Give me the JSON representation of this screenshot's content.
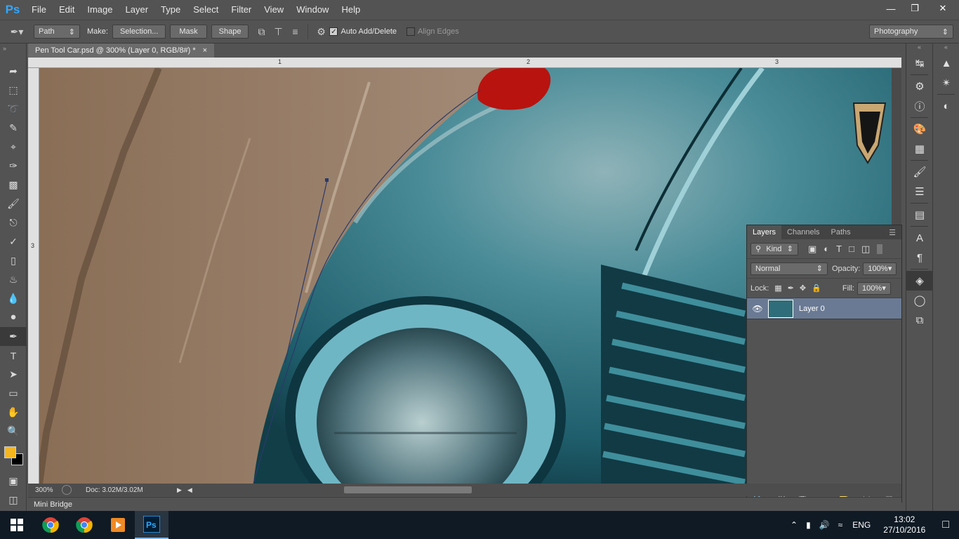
{
  "app": {
    "logo": "Ps",
    "menu": [
      "File",
      "Edit",
      "Image",
      "Layer",
      "Type",
      "Select",
      "Filter",
      "View",
      "Window",
      "Help"
    ],
    "window_controls": [
      "minimize",
      "restore",
      "close"
    ]
  },
  "options_bar": {
    "tool_mode": "Path",
    "make_label": "Make:",
    "selection_btn": "Selection...",
    "mask_btn": "Mask",
    "shape_btn": "Shape",
    "auto_add_delete": {
      "label": "Auto Add/Delete",
      "checked": true
    },
    "align_edges": {
      "label": "Align Edges",
      "checked": false
    },
    "workspace": "Photography"
  },
  "tools": [
    "move-tool",
    "marquee-tool",
    "lasso-tool",
    "quick-selection-tool",
    "crop-tool",
    "eyedropper-tool",
    "spot-healing-tool",
    "brush-tool",
    "clone-stamp-tool",
    "history-brush-tool",
    "eraser-tool",
    "paint-bucket-tool",
    "blur-tool",
    "dodge-tool",
    "pen-tool",
    "type-tool",
    "path-selection-tool",
    "rectangle-tool",
    "hand-tool",
    "zoom-tool"
  ],
  "colors": {
    "foreground": "#f4b621",
    "background": "#000000",
    "accent": "#31a8ff",
    "selected_layer": "#6a7a94"
  },
  "document": {
    "tab_title": "Pen Tool Car.psd @ 300% (Layer 0, RGB/8#) *",
    "ruler_top_marks": [
      "1",
      "2",
      "3"
    ],
    "ruler_left_mark": "3",
    "zoom": "300%",
    "doc_size": "Doc: 3.02M/3.02M"
  },
  "mini_bridge": "Mini Bridge",
  "layers_panel": {
    "tabs": [
      "Layers",
      "Channels",
      "Paths"
    ],
    "active_tab": "Layers",
    "filter_kind": "Kind",
    "blend_mode": "Normal",
    "opacity_label": "Opacity:",
    "opacity": "100%",
    "lock_label": "Lock:",
    "fill_label": "Fill:",
    "fill": "100%",
    "layers": [
      {
        "name": "Layer 0",
        "visible": true,
        "selected": true
      }
    ]
  },
  "taskbar": {
    "apps": [
      "windows-start",
      "chrome-1",
      "chrome-2",
      "media-player",
      "photoshop"
    ],
    "language": "ENG",
    "time": "13:02",
    "date": "27/10/2016"
  }
}
